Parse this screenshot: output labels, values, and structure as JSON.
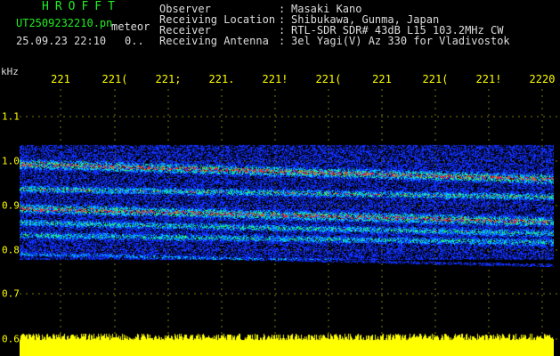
{
  "header": {
    "brand": "HROFFT",
    "filename": "UT2509232210.pn",
    "filename_suffix": "meteor",
    "datetime": "25.09.23 22:10",
    "datetime_flag": "0..",
    "meta": [
      {
        "label": "Observer",
        "value": "Masaki Kano"
      },
      {
        "label": "Receiving Location",
        "value": "Shibukawa, Gunma, Japan"
      },
      {
        "label": "Receiver",
        "value": "RTL-SDR SDR# 43dB L15 103.2MHz CW"
      },
      {
        "label": "Receiving Antenna",
        "value": "3el Yagi(V) Az 330 for Vladivostok"
      }
    ],
    "separator": ":"
  },
  "spectrogram": {
    "unit": "kHz",
    "x_ticks": [
      "221",
      "221(",
      "221;",
      "221.",
      "221!",
      "221(",
      "221",
      "221(",
      "221!",
      "2220"
    ],
    "y_ticks": [
      "1.1",
      "1.0",
      "0.9",
      "0.8",
      "0.7",
      "0.6"
    ],
    "tick_color": "#ffff00",
    "trace_colors": {
      "low": "#1030ff",
      "mid": "#00c0ff",
      "high": "#30ff60",
      "peak": "#ff2020"
    },
    "amplitude_color": "#ffff00"
  }
}
